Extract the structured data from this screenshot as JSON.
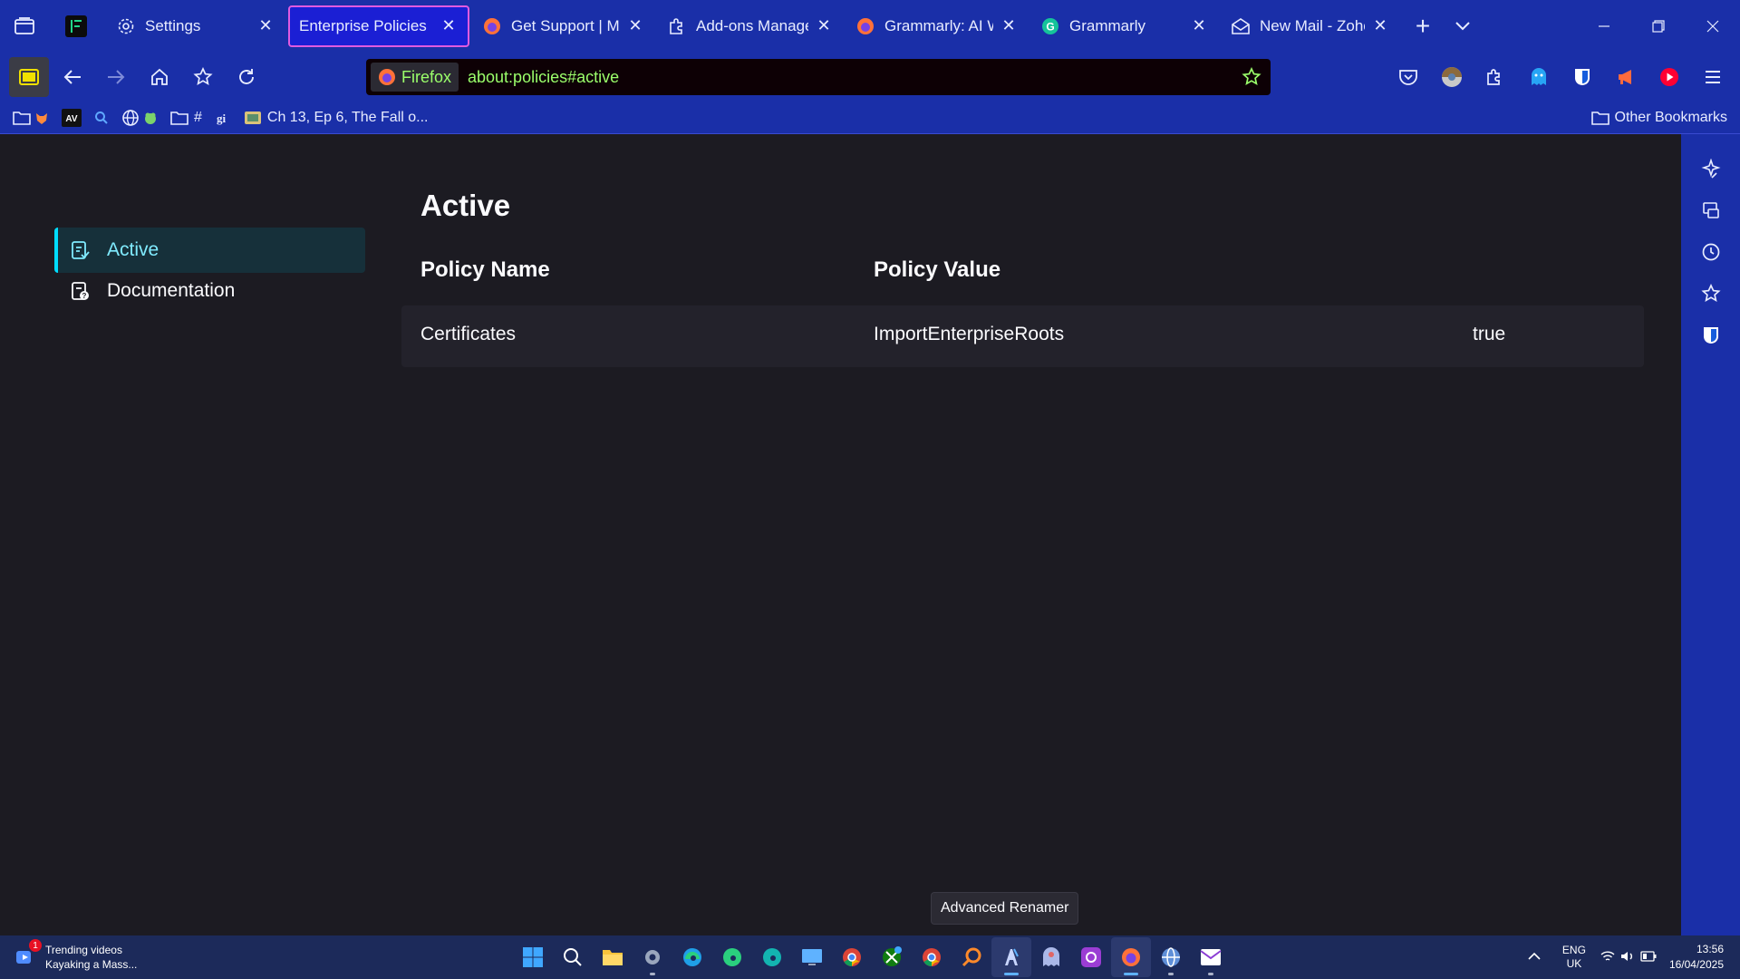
{
  "tabs": [
    {
      "name": "pinned-tab",
      "title": "",
      "icon": "app-icon"
    },
    {
      "name": "tab-settings",
      "title": "Settings",
      "icon": "gear-icon"
    },
    {
      "name": "tab-enterprise-policies",
      "title": "Enterprise Policies",
      "icon": "none",
      "selected": true
    },
    {
      "name": "tab-get-support",
      "title": "Get Support | Mozill",
      "icon": "firefox-icon"
    },
    {
      "name": "tab-addons-manager",
      "title": "Add-ons Manager",
      "icon": "puzzle-icon"
    },
    {
      "name": "tab-grammarly-ai",
      "title": "Grammarly: AI Writi",
      "icon": "firefox-icon"
    },
    {
      "name": "tab-grammarly",
      "title": "Grammarly",
      "icon": "grammarly-icon"
    },
    {
      "name": "tab-new-mail",
      "title": "New Mail - Zoho M",
      "icon": "mail-icon"
    }
  ],
  "urlbar": {
    "identity_label": "Firefox",
    "url": "about:policies#active"
  },
  "bookmarks": {
    "items": [
      {
        "label": "",
        "icon": "folder-icon"
      },
      {
        "label": "AV",
        "icon": "av-icon"
      },
      {
        "label": "",
        "icon": "search-icon"
      },
      {
        "label": "",
        "icon": "globe-icon"
      },
      {
        "label": "#",
        "icon": "folder-icon"
      },
      {
        "label": "",
        "icon": "gi-icon"
      },
      {
        "label": "Ch 13, Ep 6, The Fall o...",
        "icon": "book-icon"
      }
    ],
    "other_label": "Other Bookmarks"
  },
  "sidebar": {
    "categories": [
      {
        "label": "Active",
        "selected": true,
        "icon": "clipboard-icon"
      },
      {
        "label": "Documentation",
        "selected": false,
        "icon": "clipboard-help-icon"
      }
    ]
  },
  "main": {
    "heading": "Active",
    "columns": [
      "Policy Name",
      "Policy Value"
    ],
    "rows": [
      {
        "name": "Certificates",
        "key": "ImportEnterpriseRoots",
        "value": "true"
      }
    ]
  },
  "tooltip": "Advanced Renamer",
  "taskbar": {
    "widget_badge": "1",
    "widget_title": "Trending videos",
    "widget_subtitle": "Kayaking a Mass...",
    "lang_top": "ENG",
    "lang_bottom": "UK",
    "time": "13:56",
    "date": "16/04/2025"
  },
  "colors": {
    "chrome": "#1a2fa8",
    "accent": "#00ddff",
    "url_text": "#9bff6b",
    "content_bg": "#1c1b22"
  }
}
